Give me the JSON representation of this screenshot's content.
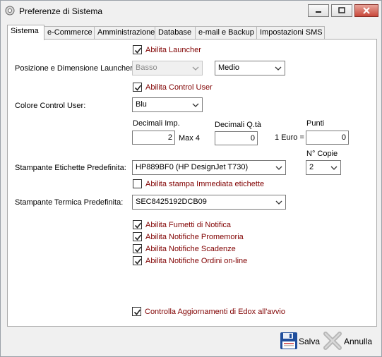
{
  "window": {
    "title": "Preferenze di Sistema"
  },
  "tabs": [
    {
      "label": "Sistema",
      "active": true
    },
    {
      "label": "e-Commerce"
    },
    {
      "label": "Amministrazione"
    },
    {
      "label": "Database"
    },
    {
      "label": "e-mail e Backup"
    },
    {
      "label": "Impostazioni SMS"
    }
  ],
  "sistema": {
    "abilita_launcher": {
      "label": "Abilita Launcher",
      "checked": true
    },
    "posizione_label": "Posizione e Dimensione Launcher:",
    "posizione_value": "Basso",
    "dimensione_value": "Medio",
    "abilita_control_user": {
      "label": "Abilita Control User",
      "checked": true
    },
    "colore_label": "Colore Control User:",
    "colore_value": "Blu",
    "decimali_imp_label": "Decimali Imp.",
    "decimali_imp_value": "2",
    "max_label": "Max 4",
    "decimali_qta_label": "Decimali Q.tà",
    "decimali_qta_value": "0",
    "euro_label": "1 Euro =",
    "punti_label": "Punti",
    "punti_value": "0",
    "ncopie_label": "N° Copie",
    "ncopie_value": "2",
    "stampante_etichette_label": "Stampante Etichette Predefinita:",
    "stampante_etichette_value": "HP889BF0 (HP DesignJet T730)",
    "stampa_immediata": {
      "label": "Abilita stampa Immediata etichette",
      "checked": false
    },
    "stampante_termica_label": "Stampante Termica Predefinita:",
    "stampante_termica_value": "SEC8425192DCB09",
    "fumetti": {
      "label": "Abilita Fumetti di Notifica",
      "checked": true
    },
    "promemoria": {
      "label": "Abilita Notifiche Promemoria",
      "checked": true
    },
    "scadenze": {
      "label": "Abilita Notifiche Scadenze",
      "checked": true
    },
    "ordini": {
      "label": "Abilita Notifiche Ordini on-line",
      "checked": true
    },
    "aggiornamenti": {
      "label": "Controlla Aggiornamenti di Edox all'avvio",
      "checked": true
    }
  },
  "footer": {
    "save_label": "Salva",
    "cancel_label": "Annulla"
  },
  "colors": {
    "checkbox_label": "#800000",
    "save_icon": "#1f4e9c",
    "cancel_icon": "#b0b0b0"
  }
}
